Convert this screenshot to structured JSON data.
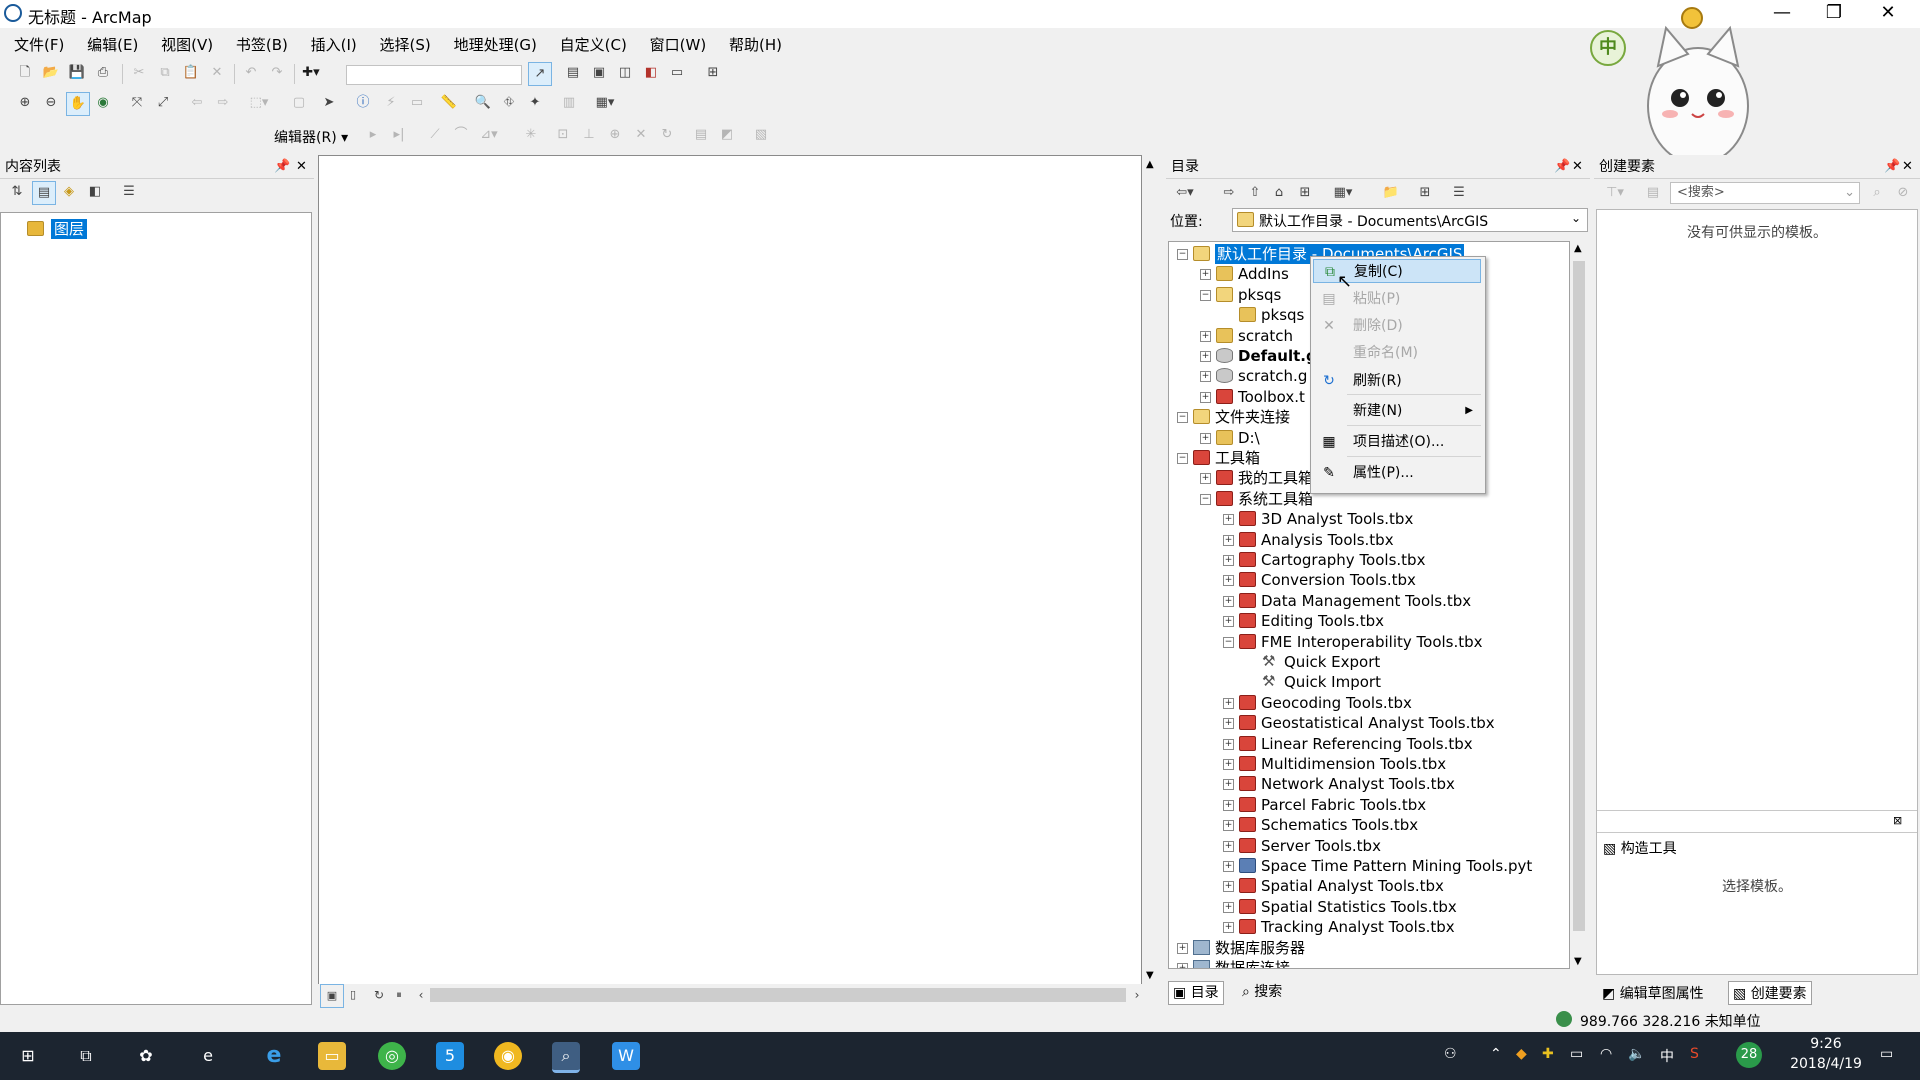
{
  "window": {
    "title": "无标题 - ArcMap",
    "controls": [
      "—",
      "❐",
      "✕"
    ]
  },
  "menu": [
    "文件(F)",
    "编辑(E)",
    "视图(V)",
    "书签(B)",
    "插入(I)",
    "选择(S)",
    "地理处理(G)",
    "自定义(C)",
    "窗口(W)",
    "帮助(H)"
  ],
  "editor_toolbar": {
    "label": "编辑器(R) ▾"
  },
  "toc": {
    "title": "内容列表",
    "layer_root": "图层"
  },
  "catalog": {
    "title": "目录",
    "location_label": "位置:",
    "location_value": "默认工作目录 - Documents\\ArcGIS",
    "tree": [
      {
        "label": "默认工作目录 - Documents\\ArcGIS",
        "icon": "folderopen",
        "level": 0,
        "exp": "−",
        "selected": true
      },
      {
        "label": "AddIns",
        "icon": "folder",
        "level": 1,
        "exp": "+"
      },
      {
        "label": "pksqs",
        "icon": "folderopen",
        "level": 1,
        "exp": "−"
      },
      {
        "label": "pksqs",
        "icon": "folder",
        "level": 2,
        "exp": ""
      },
      {
        "label": "scratch",
        "icon": "folder",
        "level": 1,
        "exp": "+"
      },
      {
        "label": "Default.g",
        "icon": "gdb",
        "level": 1,
        "exp": "+",
        "bold": true
      },
      {
        "label": "scratch.g",
        "icon": "gdb",
        "level": 1,
        "exp": "+"
      },
      {
        "label": "Toolbox.t",
        "icon": "toolbox",
        "level": 1,
        "exp": "+"
      },
      {
        "label": "文件夹连接",
        "icon": "folderopen",
        "level": 0,
        "exp": "−"
      },
      {
        "label": "D:\\",
        "icon": "folder",
        "level": 1,
        "exp": "+"
      },
      {
        "label": "工具箱",
        "icon": "toolbox",
        "level": 0,
        "exp": "−"
      },
      {
        "label": "我的工具箱",
        "icon": "toolbox",
        "level": 1,
        "exp": "+"
      },
      {
        "label": "系统工具箱",
        "icon": "toolbox",
        "level": 1,
        "exp": "−"
      },
      {
        "label": "3D Analyst Tools.tbx",
        "icon": "toolbox",
        "level": 2,
        "exp": "+"
      },
      {
        "label": "Analysis Tools.tbx",
        "icon": "toolbox",
        "level": 2,
        "exp": "+"
      },
      {
        "label": "Cartography Tools.tbx",
        "icon": "toolbox",
        "level": 2,
        "exp": "+"
      },
      {
        "label": "Conversion Tools.tbx",
        "icon": "toolbox",
        "level": 2,
        "exp": "+"
      },
      {
        "label": "Data Management Tools.tbx",
        "icon": "toolbox",
        "level": 2,
        "exp": "+"
      },
      {
        "label": "Editing Tools.tbx",
        "icon": "toolbox",
        "level": 2,
        "exp": "+"
      },
      {
        "label": "FME Interoperability Tools.tbx",
        "icon": "toolbox",
        "level": 2,
        "exp": "−"
      },
      {
        "label": "Quick Export",
        "icon": "tool",
        "level": 3,
        "exp": ""
      },
      {
        "label": "Quick Import",
        "icon": "tool",
        "level": 3,
        "exp": ""
      },
      {
        "label": "Geocoding Tools.tbx",
        "icon": "toolbox",
        "level": 2,
        "exp": "+"
      },
      {
        "label": "Geostatistical Analyst Tools.tbx",
        "icon": "toolbox",
        "level": 2,
        "exp": "+"
      },
      {
        "label": "Linear Referencing Tools.tbx",
        "icon": "toolbox",
        "level": 2,
        "exp": "+"
      },
      {
        "label": "Multidimension Tools.tbx",
        "icon": "toolbox",
        "level": 2,
        "exp": "+"
      },
      {
        "label": "Network Analyst Tools.tbx",
        "icon": "toolbox",
        "level": 2,
        "exp": "+"
      },
      {
        "label": "Parcel Fabric Tools.tbx",
        "icon": "toolbox",
        "level": 2,
        "exp": "+"
      },
      {
        "label": "Schematics Tools.tbx",
        "icon": "toolbox",
        "level": 2,
        "exp": "+"
      },
      {
        "label": "Server Tools.tbx",
        "icon": "toolbox",
        "level": 2,
        "exp": "+"
      },
      {
        "label": "Space Time Pattern Mining Tools.pyt",
        "icon": "pyt",
        "level": 2,
        "exp": "+"
      },
      {
        "label": "Spatial Analyst Tools.tbx",
        "icon": "toolbox",
        "level": 2,
        "exp": "+"
      },
      {
        "label": "Spatial Statistics Tools.tbx",
        "icon": "toolbox",
        "level": 2,
        "exp": "+"
      },
      {
        "label": "Tracking Analyst Tools.tbx",
        "icon": "toolbox",
        "level": 2,
        "exp": "+"
      },
      {
        "label": "数据库服务器",
        "icon": "server",
        "level": 0,
        "exp": "+"
      },
      {
        "label": "数据库连接",
        "icon": "server",
        "level": 0,
        "exp": "+"
      }
    ],
    "bottom_tabs": [
      "目录",
      "搜索"
    ]
  },
  "context_menu": {
    "items": [
      {
        "label": "复制(C)",
        "icon": "⧉",
        "disabled": false,
        "hover": true
      },
      {
        "label": "粘贴(P)",
        "icon": "▤",
        "disabled": true
      },
      {
        "label": "删除(D)",
        "icon": "✕",
        "disabled": true
      },
      {
        "label": "重命名(M)",
        "icon": "",
        "disabled": true
      },
      {
        "label": "刷新(R)",
        "icon": "↻",
        "disabled": false
      },
      {
        "label": "新建(N)",
        "icon": "",
        "disabled": false,
        "submenu": true
      },
      {
        "label": "项目描述(O)...",
        "icon": "▦",
        "disabled": false
      },
      {
        "label": "属性(P)...",
        "icon": "✎",
        "disabled": false
      }
    ]
  },
  "create_features": {
    "title": "创建要素",
    "search_placeholder": "<搜索>",
    "no_templates": "没有可供显示的模板。",
    "construct_tools": "构造工具",
    "select_template": "选择模板。",
    "bottom_tabs": [
      "编辑草图属性",
      "创建要素"
    ]
  },
  "status": {
    "coords": "989.766  328.216 未知单位"
  },
  "taskbar": {
    "ime": "中",
    "badge": "28",
    "time": "9:26",
    "date": "2018/4/19"
  },
  "colors": {
    "selection": "#0078d7",
    "menu_hover": "#cce4f7",
    "toolbox_red": "#d9453b",
    "taskbar": "#1c2530"
  }
}
